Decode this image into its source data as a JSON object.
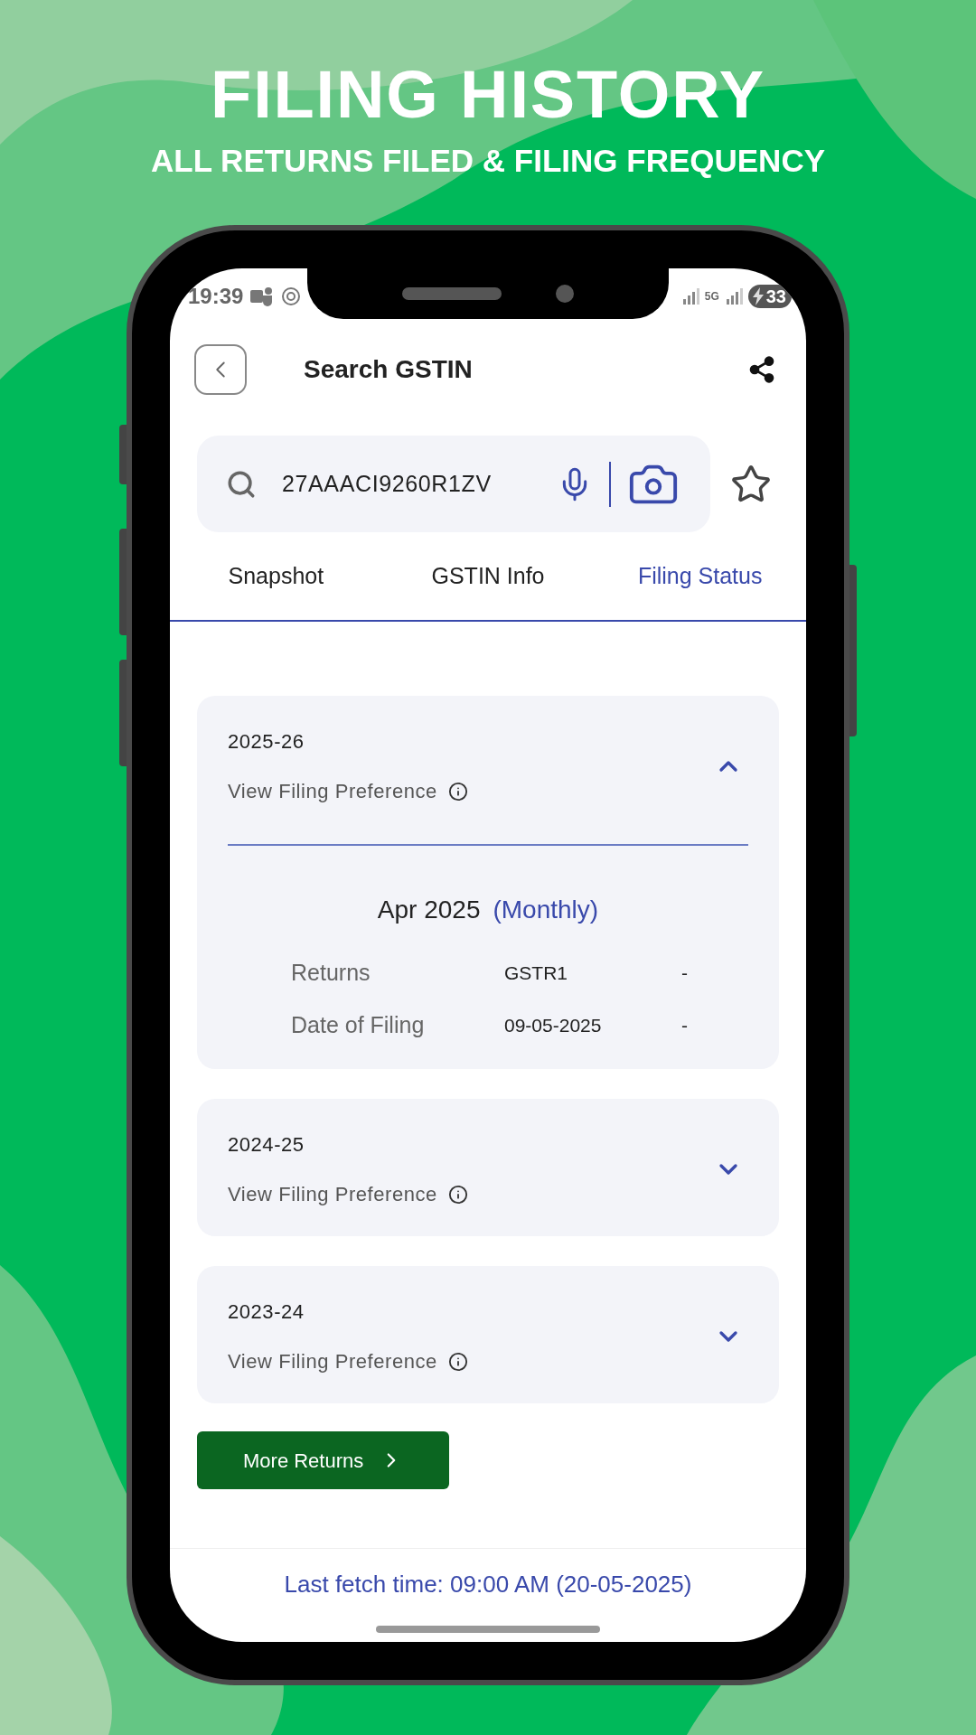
{
  "banner": {
    "title": "FILING HISTORY",
    "subtitle": "ALL RETURNS FILED & FILING FREQUENCY"
  },
  "status_bar": {
    "time": "19:39",
    "network": "5G",
    "battery": "33"
  },
  "header": {
    "title": "Search GSTIN"
  },
  "search": {
    "value": "27AAACI9260R1ZV"
  },
  "tabs": [
    {
      "label": "Snapshot",
      "selected": false
    },
    {
      "label": "GSTIN Info",
      "selected": false
    },
    {
      "label": "Filing Status",
      "selected": true
    }
  ],
  "years": [
    {
      "label": "2025-26",
      "link": "View Filing Preference",
      "expanded": true,
      "period": "Apr 2025",
      "frequency": "(Monthly)",
      "rows": [
        {
          "label": "Returns",
          "value": "GSTR1",
          "extra": "-"
        },
        {
          "label": "Date of Filing",
          "value": "09-05-2025",
          "extra": "-"
        }
      ]
    },
    {
      "label": "2024-25",
      "link": "View Filing Preference",
      "expanded": false
    },
    {
      "label": "2023-24",
      "link": "View Filing Preference",
      "expanded": false
    }
  ],
  "more_button": "More Returns",
  "footer": "Last fetch time: 09:00 AM (20-05-2025)"
}
